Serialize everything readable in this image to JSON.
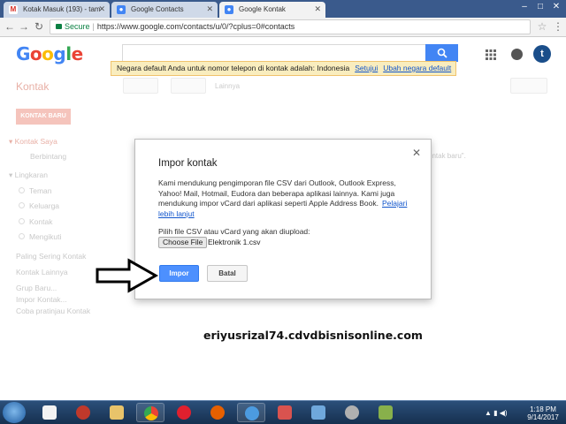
{
  "browser": {
    "tabs": [
      {
        "title": "Kotak Masuk (193) - tam",
        "favicon": "gmail-icon",
        "active": false
      },
      {
        "title": "Google Contacts",
        "favicon": "contacts-icon",
        "active": false
      },
      {
        "title": "Google Kontak",
        "favicon": "contacts-icon",
        "active": true
      }
    ],
    "secure_label": "Secure",
    "url": "https://www.google.com/contacts/u/0/?cplus=0#contacts"
  },
  "header": {
    "logo_text": "Google",
    "avatar_letter": "t"
  },
  "notice": {
    "text": "Negara default Anda untuk nomor telepon di kontak adalah: Indonesia",
    "agree_link": "Setujui",
    "change_link": "Ubah negara default"
  },
  "app": {
    "title": "Kontak",
    "more_label": "Lainnya",
    "new_contact_button": "KONTAK BARU",
    "sidebar": {
      "my_contacts": "Kontak Saya",
      "starred": "Berbintang",
      "circles": "Lingkaran",
      "circle_items": [
        "Teman",
        "Keluarga",
        "Kontak",
        "Mengikuti"
      ],
      "most_contacted": "Paling Sering Kontak",
      "other_contacts": "Kontak Lainnya",
      "new_group": "Grup Baru...",
      "import": "Impor Kontak...",
      "try_preview": "Coba pratinjau Kontak"
    },
    "right_fade_text": "ontak baru\"."
  },
  "dialog": {
    "title": "Impor kontak",
    "description": "Kami mendukung pengimporan file CSV dari Outlook, Outlook Express, Yahoo! Mail, Hotmail, Eudora dan beberapa aplikasi lainnya. Kami juga mendukung impor vCard dari aplikasi seperti Apple Address Book.",
    "learn_more": "Pelajari lebih lanjut",
    "pick_label": "Pilih file CSV atau vCard yang akan diupload:",
    "choose_file_button": "Choose File",
    "file_name": "Elektronik 1.csv",
    "import_button": "Impor",
    "cancel_button": "Batal"
  },
  "watermark": "eriyusrizal74.cdvdbisnisonline.com",
  "taskbar": {
    "time": "1:18 PM",
    "date": "9/14/2017"
  },
  "colors": {
    "accent_blue": "#4d90fe",
    "notice_bg": "#f9edbe",
    "taskbar": "#1e3d63"
  }
}
